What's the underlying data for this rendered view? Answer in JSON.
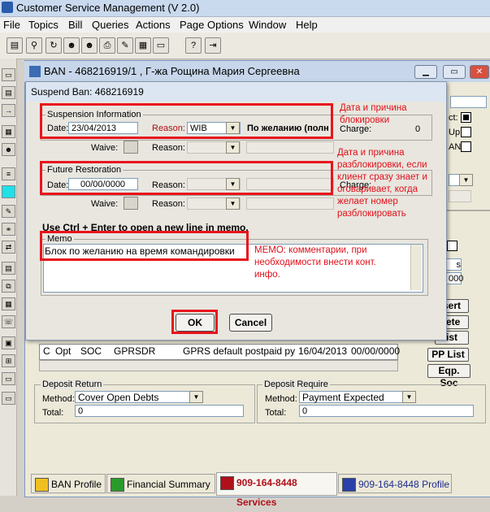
{
  "app": {
    "title": "Customer Service Management  (V 2.0)"
  },
  "menu": [
    "File",
    "Topics",
    "Bill",
    "Queries",
    "Actions",
    "Page Options",
    "Window",
    "Help"
  ],
  "ban_window": {
    "title": "BAN - 468216919/1 , Г-жа Рощина Мария Сергеевна"
  },
  "dialog": {
    "title": "Suspend Ban: 468216919",
    "suspension": {
      "group_label": "Suspension Information",
      "date_label": "Date:",
      "date_value": "23/04/2013",
      "reason_label": "Reason:",
      "reason_value": "WIB",
      "reason_desc": "По желанию (полн",
      "charge_label": "Charge:",
      "charge_value": "0",
      "waive_label": "Waive:",
      "reason2_label": "Reason:"
    },
    "future": {
      "group_label": "Future Restoration",
      "date_label": "Date:",
      "date_value": "00/00/0000",
      "reason_label": "Reason:",
      "charge_label": "Charge:",
      "waive_label": "Waive:",
      "reason2_label": "Reason:"
    },
    "hint": "Use Ctrl + Enter to open a new line in memo.",
    "memo": {
      "label": "Memo",
      "value": "Блок по желанию на время командировки"
    },
    "ok_label": "OK",
    "cancel_label": "Cancel"
  },
  "annotations": {
    "a1": [
      "Дата и причина",
      "блокировки"
    ],
    "a2": [
      "Дата и причина",
      "разблокировки, если",
      "клиент сразу знает и",
      "оговаривает, когда",
      "желает номер",
      "разблокировать"
    ],
    "a3": [
      "МЕМО: комментарии, при",
      "необходимости внести конт.",
      "инфо."
    ]
  },
  "right_panel": {
    "items": [
      "ct:",
      "Up:",
      "AN:"
    ],
    "numbers": [
      "s",
      "000"
    ],
    "buttons": [
      "sert",
      "lete",
      "ist",
      "PP List",
      "Eqp. Soc"
    ]
  },
  "services_row": [
    "C",
    "Opt",
    "SOC",
    "GPRSDR",
    "GPRS default postpaid pyı",
    "16/04/2013",
    "00/00/0000"
  ],
  "deposit_return": {
    "label": "Deposit Return",
    "method_label": "Method:",
    "method_value": "Cover Open Debts",
    "total_label": "Total:",
    "total_value": "0"
  },
  "deposit_require": {
    "label": "Deposit Require",
    "method_label": "Method:",
    "method_value": "Payment Expected",
    "total_label": "Total:",
    "total_value": "0"
  },
  "tabs": [
    "BAN Profile",
    "Financial Summary",
    "909-164-8448 Services",
    "909-164-8448 Profile"
  ],
  "colors": {
    "annotation_red": "#e8151c",
    "title_blue": "#c7d6ea"
  }
}
